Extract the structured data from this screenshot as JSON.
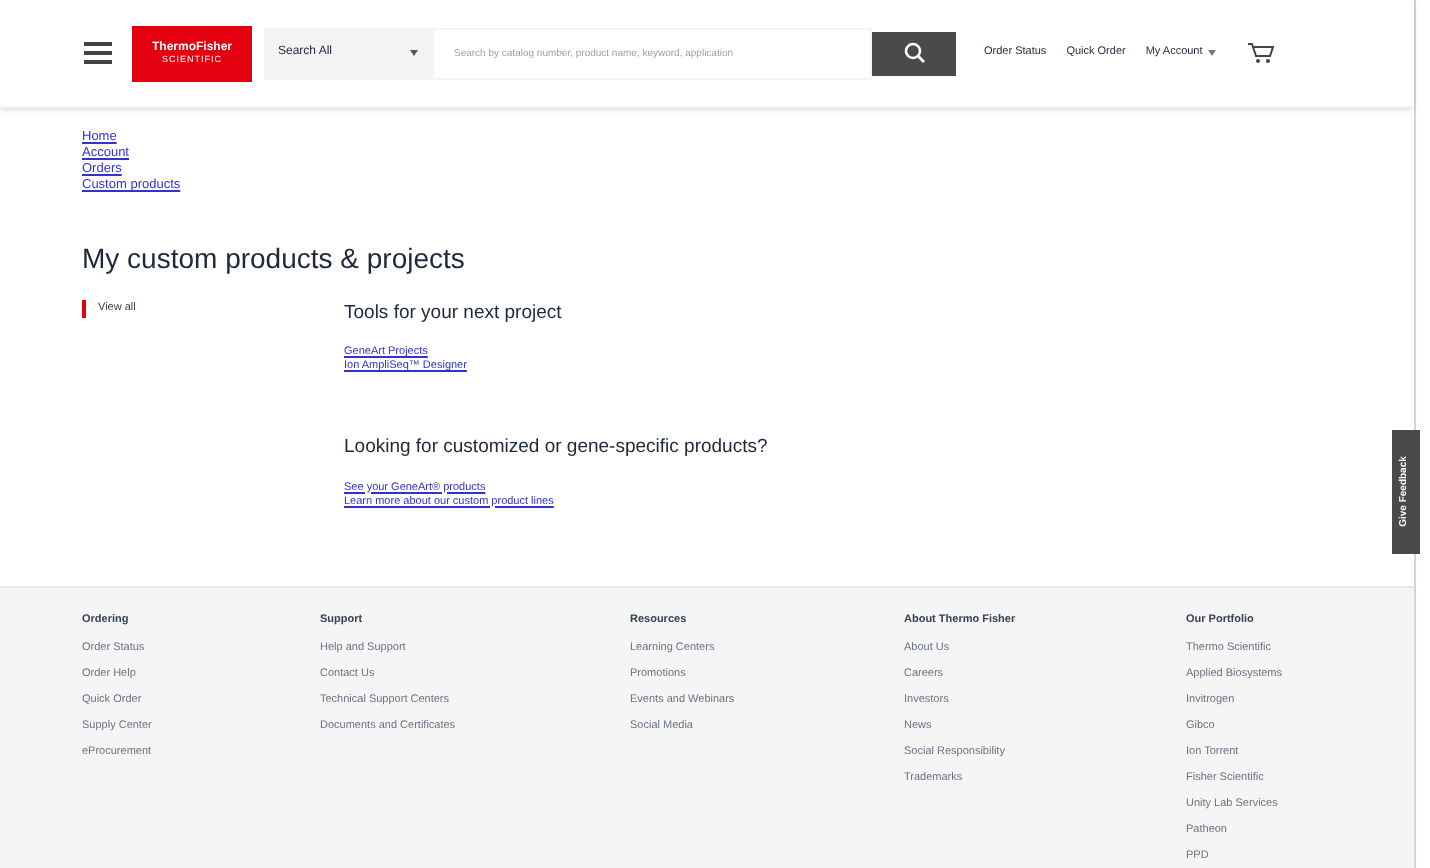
{
  "header": {
    "logo": {
      "brand": "ThermoFisher",
      "tagline": "SCIENTIFIC"
    },
    "search_scope": "Search All",
    "search": {
      "placeholder": "Search by catalog number, product name, keyword, application"
    },
    "nav": [
      "Order Status",
      "Quick Order",
      "My Account"
    ]
  },
  "breadcrumbs": [
    "Home",
    "Account",
    "Orders",
    "Custom products"
  ],
  "title": "My custom products & projects",
  "sidebar": {
    "items": [
      {
        "label": "View all",
        "selected": true
      }
    ]
  },
  "sections": [
    {
      "heading": "Tools for your next project",
      "links": [
        "GeneArt Projects",
        "Ion AmpliSeq™ Designer"
      ]
    },
    {
      "heading": "Looking for customized or gene-specific products?",
      "links": [
        "See your GeneArt® products",
        "Learn more about our custom product lines"
      ]
    }
  ],
  "feedback_tab": "Give Feedback",
  "footer": [
    {
      "heading": "Ordering",
      "links": [
        "Order Status",
        "Order Help",
        "Quick Order",
        "Supply Center",
        "eProcurement"
      ]
    },
    {
      "heading": "Support",
      "links": [
        "Help and Support",
        "Contact Us",
        "Technical Support Centers",
        "Documents and Certificates"
      ]
    },
    {
      "heading": "Resources",
      "links": [
        "Learning Centers",
        "Promotions",
        "Events and Webinars",
        "Social Media"
      ]
    },
    {
      "heading": "About Thermo Fisher",
      "links": [
        "About Us",
        "Careers",
        "Investors",
        "News",
        "Social Responsibility",
        "Trademarks"
      ]
    },
    {
      "heading": "Our Portfolio",
      "links": [
        "Thermo Scientific",
        "Applied Biosystems",
        "Invitrogen",
        "Gibco",
        "Ion Torrent",
        "Fisher Scientific",
        "Unity Lab Services",
        "Patheon",
        "PPD"
      ]
    }
  ]
}
